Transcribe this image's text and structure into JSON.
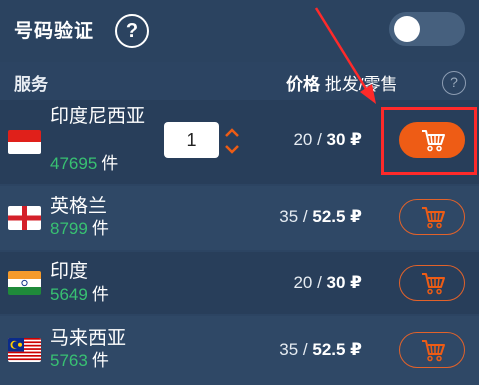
{
  "header": {
    "title": "号码验证",
    "help_icon": "?",
    "toggle_state": "off"
  },
  "columns": {
    "service": "服务",
    "price_bold": "价格",
    "price_rest": " 批发/零售",
    "help_icon": "?"
  },
  "rows": [
    {
      "country": "印度尼西亚",
      "count": "47695",
      "unit": "件",
      "wholesale": "20 / ",
      "retail": "30 ₽",
      "flag": "indonesia-flag",
      "quantity": "1"
    },
    {
      "country": "英格兰",
      "count": "8799",
      "unit": "件",
      "wholesale": "35 / ",
      "retail": "52.5 ₽",
      "flag": "england-flag"
    },
    {
      "country": "印度",
      "count": "5649",
      "unit": "件",
      "wholesale": "20 / ",
      "retail": "30 ₽",
      "flag": "india-flag"
    },
    {
      "country": "马来西亚",
      "count": "5763",
      "unit": "件",
      "wholesale": "35 / ",
      "retail": "52.5 ₽",
      "flag": "malaysia-flag"
    }
  ],
  "colors": {
    "background": "#2c4462",
    "accent": "#ee5c15",
    "count_green": "#38c172",
    "highlight_red": "#ff2a2a"
  },
  "icons": [
    "help-icon",
    "cart-icon",
    "chevron-up-icon",
    "chevron-down-icon",
    "annotation-arrow"
  ]
}
